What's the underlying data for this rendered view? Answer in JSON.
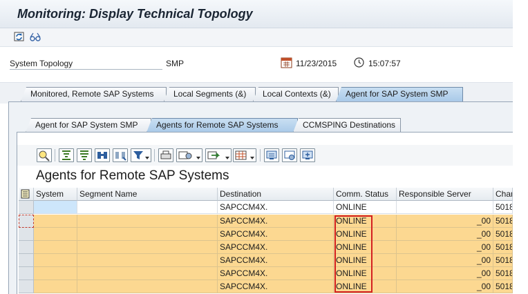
{
  "window": {
    "title": "Monitoring: Display Technical Topology"
  },
  "header": {
    "topology_label": "System Topology",
    "topology_value": "SMP",
    "date": "11/23/2015",
    "time": "15:07:57"
  },
  "outer_tabs": [
    {
      "label": "Monitored, Remote SAP Systems",
      "active": false
    },
    {
      "label": "Local Segments (&)",
      "active": false
    },
    {
      "label": "Local Contexts (&)",
      "active": false
    },
    {
      "label": "Agent for SAP System SMP",
      "active": true
    }
  ],
  "inner_tabs": [
    {
      "label": "Agent for SAP System SMP",
      "active": false
    },
    {
      "label": "Agents for Remote SAP Systems",
      "active": true
    },
    {
      "label": "CCMSPING Destinations",
      "active": false
    }
  ],
  "grid": {
    "title": "Agents for Remote SAP Systems",
    "columns": [
      "System",
      "Segment Name",
      "Destination",
      "Comm. Status",
      "Responsible Server",
      "Chan"
    ],
    "rows": [
      {
        "system": "",
        "segment": "",
        "destination": "SAPCCM4X.",
        "status": "ONLINE",
        "server": "",
        "chan": "5018",
        "selected": false
      },
      {
        "system": "",
        "segment": "",
        "destination": "SAPCCM4X.",
        "status": "ONLINE",
        "server": "_00",
        "chan": "5018",
        "selected": true
      },
      {
        "system": "",
        "segment": "",
        "destination": "SAPCCM4X.",
        "status": "ONLINE",
        "server": "_00",
        "chan": "5018",
        "selected": true
      },
      {
        "system": "",
        "segment": "",
        "destination": "SAPCCM4X.",
        "status": "ONLINE",
        "server": "_00",
        "chan": "5018",
        "selected": true
      },
      {
        "system": "",
        "segment": "",
        "destination": "SAPCCM4X.",
        "status": "ONLINE",
        "server": "_00",
        "chan": "5018",
        "selected": true
      },
      {
        "system": "",
        "segment": "",
        "destination": "SAPCCM4X.",
        "status": "ONLINE",
        "server": "_00",
        "chan": "5018",
        "selected": true
      },
      {
        "system": "",
        "segment": "",
        "destination": "SAPCCM4X.",
        "status": "ONLINE",
        "server": "_00",
        "chan": "5018",
        "selected": true
      }
    ]
  },
  "icons": {
    "toolbar": [
      "refresh-icon",
      "glasses-icon"
    ],
    "alv": [
      "details-icon",
      "sort-ascending-icon",
      "sort-descending-icon",
      "find-icon",
      "find-next-icon",
      "filter-icon",
      "print-icon",
      "views-icon",
      "export-icon",
      "layout-icon",
      "create-icon",
      "change-icon",
      "display-icon"
    ]
  },
  "colors": {
    "selected_row": "#fcd891",
    "highlight_box": "#d32020",
    "active_tab": "#a9c9e8"
  }
}
